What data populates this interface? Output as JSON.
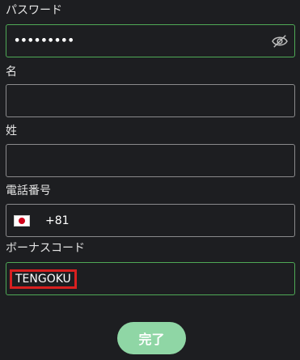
{
  "form": {
    "password": {
      "label": "パスワード",
      "value": "•••••••••",
      "visibility_icon": "eye-slash-icon"
    },
    "first_name": {
      "label": "名",
      "value": ""
    },
    "last_name": {
      "label": "姓",
      "value": ""
    },
    "phone": {
      "label": "電話番号",
      "flag_icon": "japan-flag-icon",
      "dial_code": "+81",
      "value": ""
    },
    "bonus_code": {
      "label": "ボーナスコード",
      "value": "TENGOKU"
    },
    "submit_label": "完了"
  },
  "colors": {
    "background": "#1d1e21",
    "active_border": "#4fa956",
    "submit_button": "#8fd6a5",
    "highlight": "#d82020"
  }
}
